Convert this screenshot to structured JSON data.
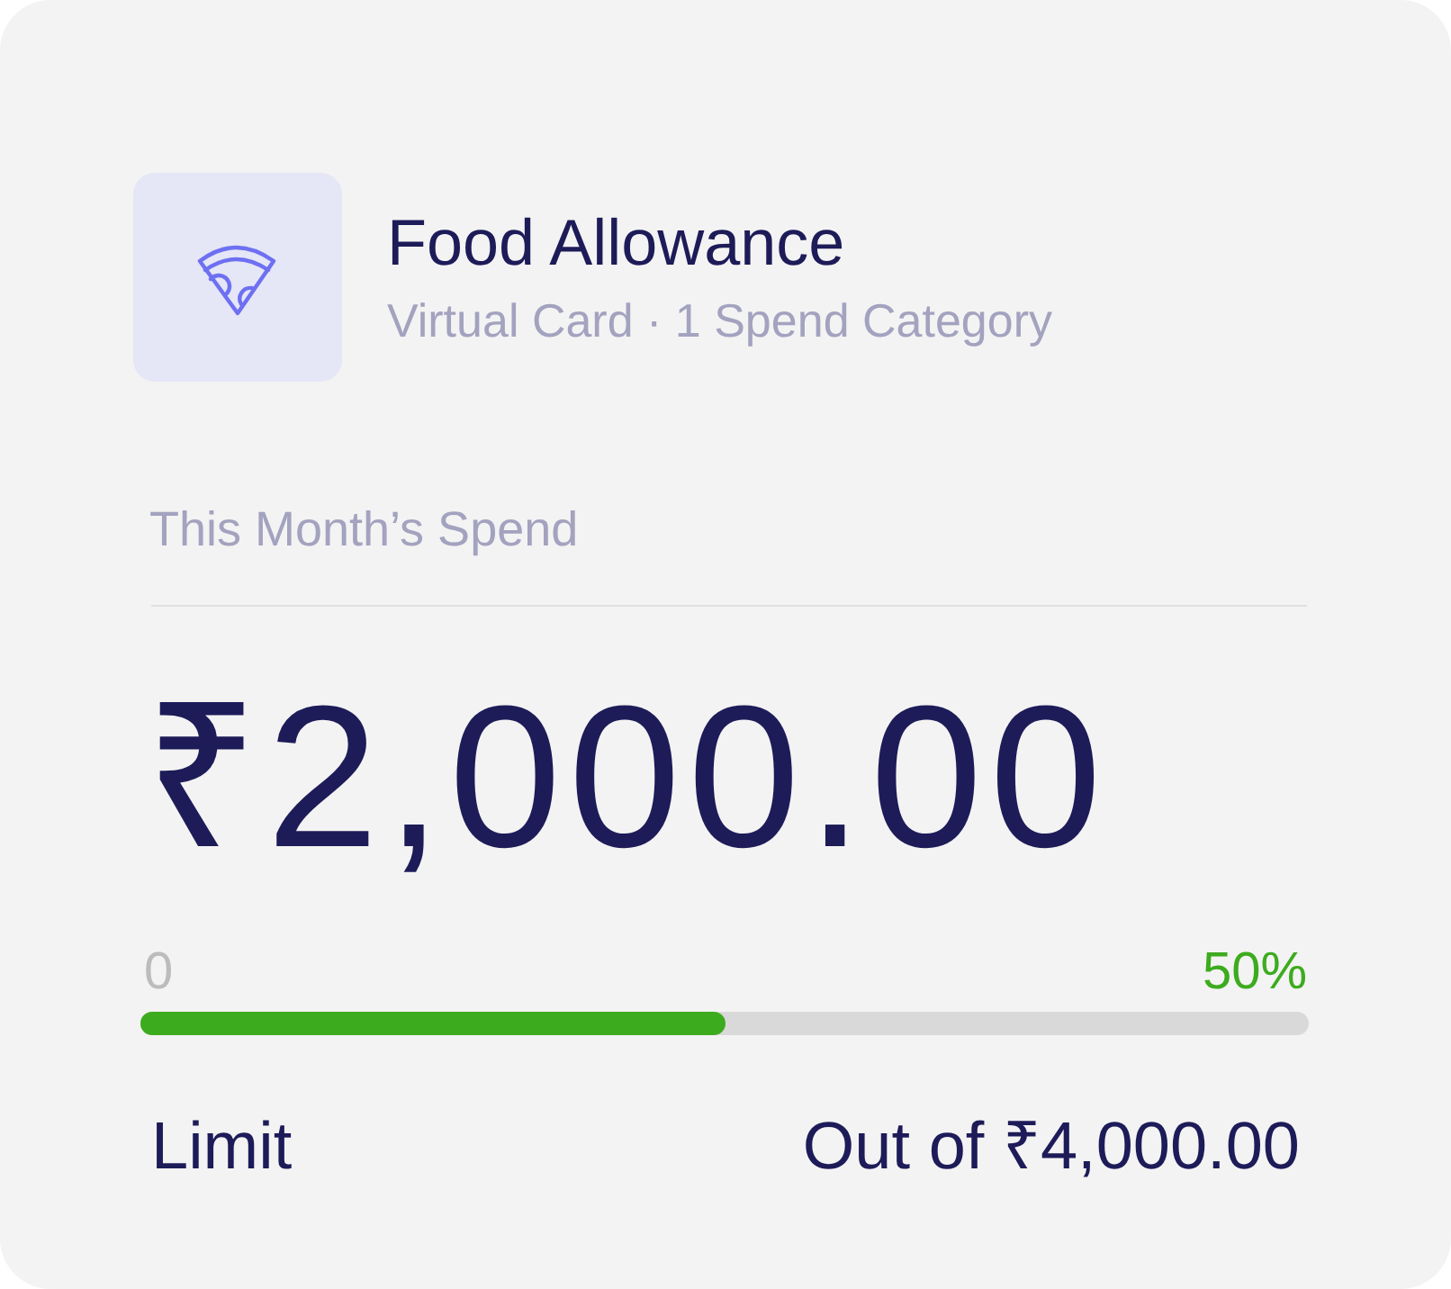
{
  "card": {
    "title": "Food Allowance",
    "subtitle": "Virtual Card · 1 Spend Category"
  },
  "spend": {
    "label": "This Month’s Spend",
    "amount": "₹2,000.00"
  },
  "progress": {
    "start_label": "0",
    "percent_label": "50%",
    "level": 0.5
  },
  "limit": {
    "label": "Limit",
    "value": "Out of ₹4,000.00"
  }
}
